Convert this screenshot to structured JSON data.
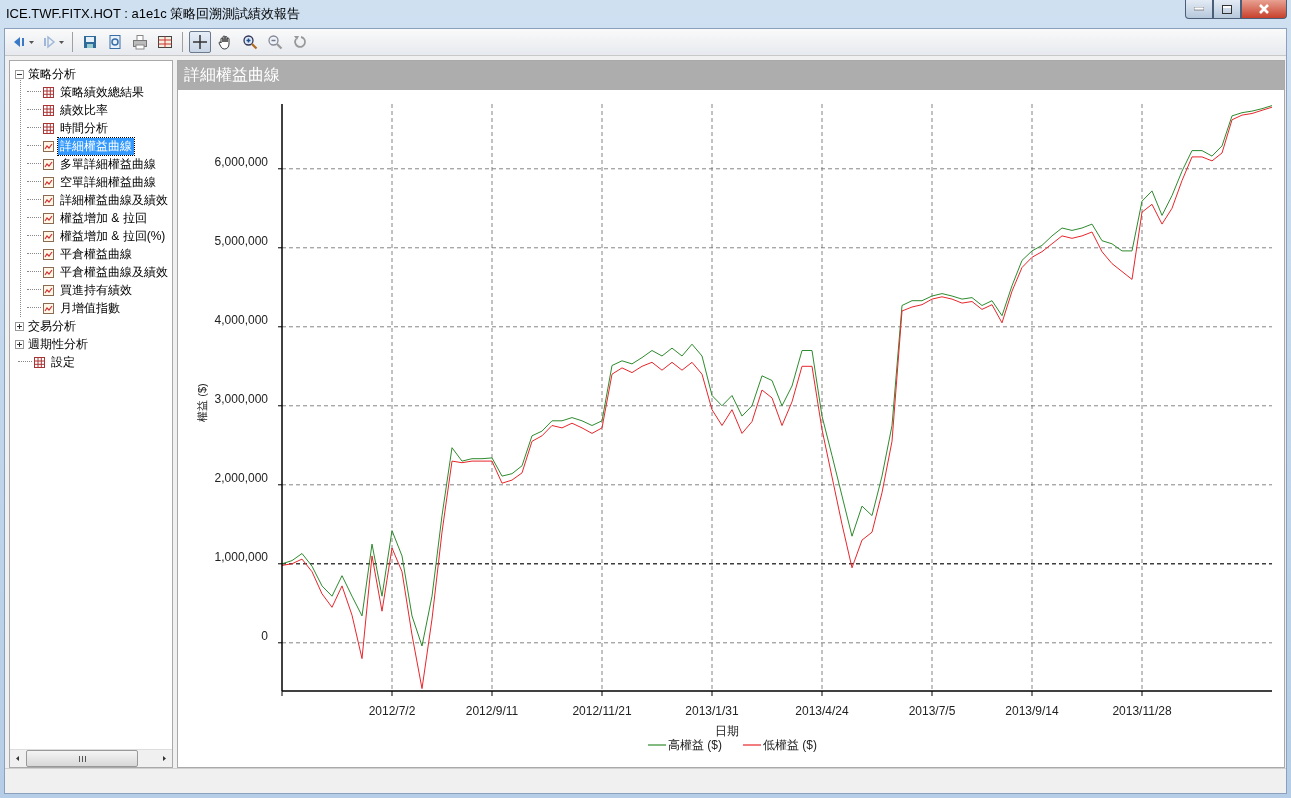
{
  "window": {
    "title": "ICE.TWF.FITX.HOT : a1e1c 策略回溯測試績效報告"
  },
  "toolbar": [
    {
      "kind": "back",
      "dropdown": true,
      "selected": false
    },
    {
      "kind": "forward",
      "dropdown": true,
      "selected": false
    },
    {
      "kind": "separator"
    },
    {
      "kind": "save",
      "selected": false
    },
    {
      "kind": "preview",
      "selected": false
    },
    {
      "kind": "print",
      "selected": false
    },
    {
      "kind": "grid",
      "selected": false
    },
    {
      "kind": "separator"
    },
    {
      "kind": "crosshair",
      "selected": true
    },
    {
      "kind": "hand",
      "selected": false
    },
    {
      "kind": "zoom-in",
      "selected": false
    },
    {
      "kind": "zoom-out",
      "selected": false
    },
    {
      "kind": "reset",
      "selected": false
    }
  ],
  "tree": [
    {
      "label": "策略分析",
      "expanded": true,
      "children": [
        {
          "label": "策略績效總結果",
          "kind": "table",
          "selected": false
        },
        {
          "label": "績效比率",
          "kind": "table",
          "selected": false
        },
        {
          "label": "時間分析",
          "kind": "table",
          "selected": false
        },
        {
          "label": "詳細權益曲線",
          "kind": "chart",
          "selected": true
        },
        {
          "label": "多單詳細權益曲線",
          "kind": "chart",
          "selected": false
        },
        {
          "label": "空單詳細權益曲線",
          "kind": "chart",
          "selected": false
        },
        {
          "label": "詳細權益曲線及績效",
          "kind": "chart",
          "selected": false
        },
        {
          "label": "權益增加 & 拉回",
          "kind": "chart",
          "selected": false
        },
        {
          "label": "權益增加 & 拉回(%)",
          "kind": "chart",
          "selected": false
        },
        {
          "label": "平倉權益曲線",
          "kind": "chart",
          "selected": false
        },
        {
          "label": "平倉權益曲線及績效",
          "kind": "chart",
          "selected": false
        },
        {
          "label": "買進持有績效",
          "kind": "chart",
          "selected": false
        },
        {
          "label": "月增值指數",
          "kind": "chart",
          "selected": false
        }
      ]
    },
    {
      "label": "交易分析",
      "expanded": false
    },
    {
      "label": "週期性分析",
      "expanded": false
    },
    {
      "label": "設定",
      "kind": "table",
      "selected": false
    }
  ],
  "panel": {
    "title": "詳細權益曲線",
    "chart_data": {
      "type": "line",
      "xlabel": "日期",
      "ylabel": "權益 ($)",
      "categories": [
        null,
        null,
        null,
        null,
        null,
        null,
        null,
        null,
        null,
        null,
        null,
        "2012/7/2",
        null,
        null,
        null,
        null,
        null,
        null,
        null,
        null,
        null,
        "2012/9/11",
        null,
        null,
        null,
        null,
        null,
        null,
        null,
        null,
        null,
        null,
        "2012/11/21",
        null,
        null,
        null,
        null,
        null,
        null,
        null,
        null,
        null,
        null,
        "2013/1/31",
        null,
        null,
        null,
        null,
        null,
        null,
        null,
        null,
        null,
        null,
        "2013/4/24",
        null,
        null,
        null,
        null,
        null,
        null,
        null,
        null,
        null,
        null,
        "2013/7/5",
        null,
        null,
        null,
        null,
        null,
        null,
        null,
        null,
        null,
        "2013/9/14",
        null,
        null,
        null,
        null,
        null,
        null,
        null,
        null,
        null,
        null,
        "2013/11/28",
        null,
        null,
        null,
        null,
        null,
        null,
        null,
        null,
        null,
        null,
        null,
        null,
        null
      ],
      "series": [
        {
          "name": "高權益 ($)",
          "color": "#2e8b2e",
          "values": [
            1000000,
            1040000,
            1130000,
            970000,
            720000,
            590000,
            850000,
            590000,
            340000,
            1250000,
            590000,
            1420000,
            1100000,
            340000,
            -40000,
            590000,
            1610000,
            2470000,
            2300000,
            2330000,
            2330000,
            2340000,
            2110000,
            2140000,
            2240000,
            2620000,
            2680000,
            2810000,
            2810000,
            2850000,
            2810000,
            2750000,
            2810000,
            3510000,
            3570000,
            3530000,
            3610000,
            3700000,
            3630000,
            3730000,
            3630000,
            3780000,
            3630000,
            3130000,
            3000000,
            3130000,
            2870000,
            3000000,
            3380000,
            3320000,
            3000000,
            3250000,
            3700000,
            3700000,
            2870000,
            2370000,
            1860000,
            1350000,
            1730000,
            1610000,
            2110000,
            2750000,
            4270000,
            4330000,
            4330000,
            4390000,
            4420000,
            4390000,
            4350000,
            4370000,
            4270000,
            4330000,
            4140000,
            4520000,
            4840000,
            4960000,
            5030000,
            5150000,
            5250000,
            5220000,
            5250000,
            5300000,
            5090000,
            5050000,
            4960000,
            4960000,
            5590000,
            5720000,
            5410000,
            5660000,
            5970000,
            6230000,
            6230000,
            6160000,
            6290000,
            6670000,
            6710000,
            6730000,
            6760000,
            6800000
          ]
        },
        {
          "name": "低權益 ($)",
          "color": "#e8262b",
          "values": [
            980000,
            1000000,
            1060000,
            900000,
            620000,
            450000,
            720000,
            350000,
            -200000,
            1100000,
            400000,
            1200000,
            900000,
            100000,
            -580000,
            300000,
            1400000,
            2300000,
            2280000,
            2300000,
            2300000,
            2300000,
            2020000,
            2060000,
            2150000,
            2550000,
            2620000,
            2750000,
            2720000,
            2780000,
            2720000,
            2650000,
            2720000,
            3400000,
            3480000,
            3420000,
            3500000,
            3550000,
            3450000,
            3550000,
            3450000,
            3550000,
            3400000,
            2950000,
            2750000,
            2950000,
            2650000,
            2800000,
            3200000,
            3100000,
            2750000,
            3050000,
            3500000,
            3500000,
            2700000,
            2100000,
            1500000,
            950000,
            1300000,
            1400000,
            1900000,
            2550000,
            4200000,
            4250000,
            4280000,
            4350000,
            4380000,
            4350000,
            4300000,
            4320000,
            4220000,
            4280000,
            4050000,
            4450000,
            4750000,
            4880000,
            4950000,
            5050000,
            5150000,
            5120000,
            5150000,
            5200000,
            4950000,
            4800000,
            4700000,
            4600000,
            5450000,
            5550000,
            5300000,
            5500000,
            5850000,
            6150000,
            6150000,
            6100000,
            6200000,
            6620000,
            6680000,
            6700000,
            6740000,
            6780000
          ]
        }
      ],
      "ylim": [
        -610000,
        6820000
      ],
      "grid": true,
      "legend": true,
      "ref_lines": [
        {
          "axis": "y",
          "value": 1000000,
          "color": "#111111"
        }
      ],
      "yticks": [
        {
          "value": 0,
          "label": "0"
        },
        {
          "value": 1000000,
          "label": "1,000,000"
        },
        {
          "value": 2000000,
          "label": "2,000,000"
        },
        {
          "value": 3000000,
          "label": "3,000,000"
        },
        {
          "value": 4000000,
          "label": "4,000,000"
        },
        {
          "value": 5000000,
          "label": "5,000,000"
        },
        {
          "value": 6000000,
          "label": "6,000,000"
        }
      ]
    }
  }
}
